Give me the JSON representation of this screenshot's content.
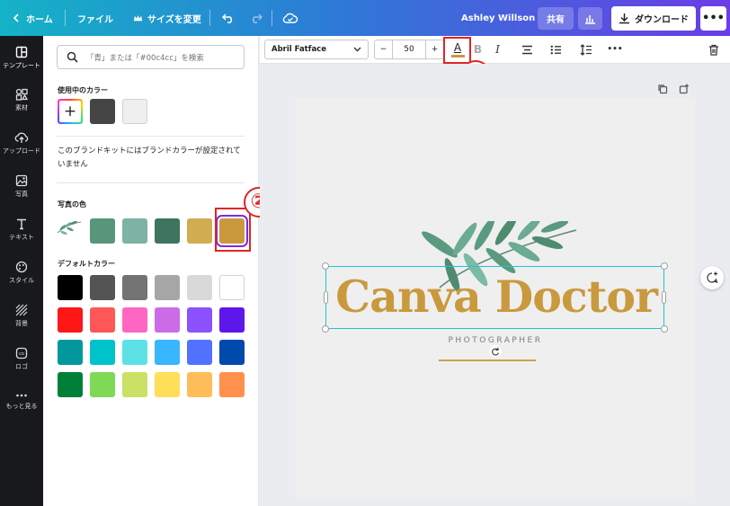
{
  "topbar": {
    "home_label": "ホーム",
    "file_label": "ファイル",
    "resize_label": "サイズを変更",
    "user_name": "Ashley Willson",
    "share_label": "共有",
    "download_label": "ダウンロード",
    "more_label": "•••",
    "icons": [
      "chevron-left-icon",
      "crown-icon",
      "undo-icon",
      "redo-icon",
      "cloud-sync-icon",
      "bar-chart-icon",
      "download-icon",
      "more-icon"
    ]
  },
  "rail": {
    "items": [
      {
        "label": "テンプレート",
        "icon": "template-icon"
      },
      {
        "label": "素材",
        "icon": "elements-icon"
      },
      {
        "label": "アップロード",
        "icon": "upload-icon"
      },
      {
        "label": "写真",
        "icon": "photo-icon"
      },
      {
        "label": "テキスト",
        "icon": "text-icon"
      },
      {
        "label": "スタイル",
        "icon": "style-icon"
      },
      {
        "label": "背景",
        "icon": "background-icon"
      },
      {
        "label": "ロゴ",
        "icon": "logo-icon"
      },
      {
        "label": "もっと見る",
        "icon": "more-icon"
      }
    ]
  },
  "panel": {
    "search_placeholder": "「青」または「#00c4cc」を検索",
    "in_use_title": "使用中のカラー",
    "in_use_colors": [
      "#454545",
      "#efefef"
    ],
    "brand_note": "このブランドキットにはブランドカラーが設定されていません",
    "photo_title": "写真の色",
    "photo_colors": [
      "#58957b",
      "#7cb3a4",
      "#3f755f",
      "#d1ad50",
      "#c9993e"
    ],
    "default_title": "デフォルトカラー",
    "default_colors": [
      [
        "#000000",
        "#545454",
        "#737373",
        "#a6a6a6",
        "#d9d9d9",
        "#ffffff"
      ],
      [
        "#ff1616",
        "#ff5757",
        "#ff66c4",
        "#cb6ce6",
        "#8c52ff",
        "#5e17eb"
      ],
      [
        "#03989e",
        "#00c2cb",
        "#5ce1e6",
        "#38b6ff",
        "#5271ff",
        "#004aad"
      ],
      [
        "#008037",
        "#7ed957",
        "#c9e265",
        "#ffde59",
        "#ffbd59",
        "#ff914d"
      ]
    ],
    "callout_2": "②"
  },
  "toolbar": {
    "font_name": "Abril Fatface",
    "font_size": "50",
    "minus": "−",
    "plus": "+",
    "text_color_glyph": "A",
    "bold_glyph": "B",
    "italic_glyph": "I",
    "more_label": "•••",
    "callout_1": "①"
  },
  "canvas": {
    "title": "Canva Doctor",
    "subtitle": "PHOTOGRAPHER",
    "text_color": "#c9993e"
  }
}
